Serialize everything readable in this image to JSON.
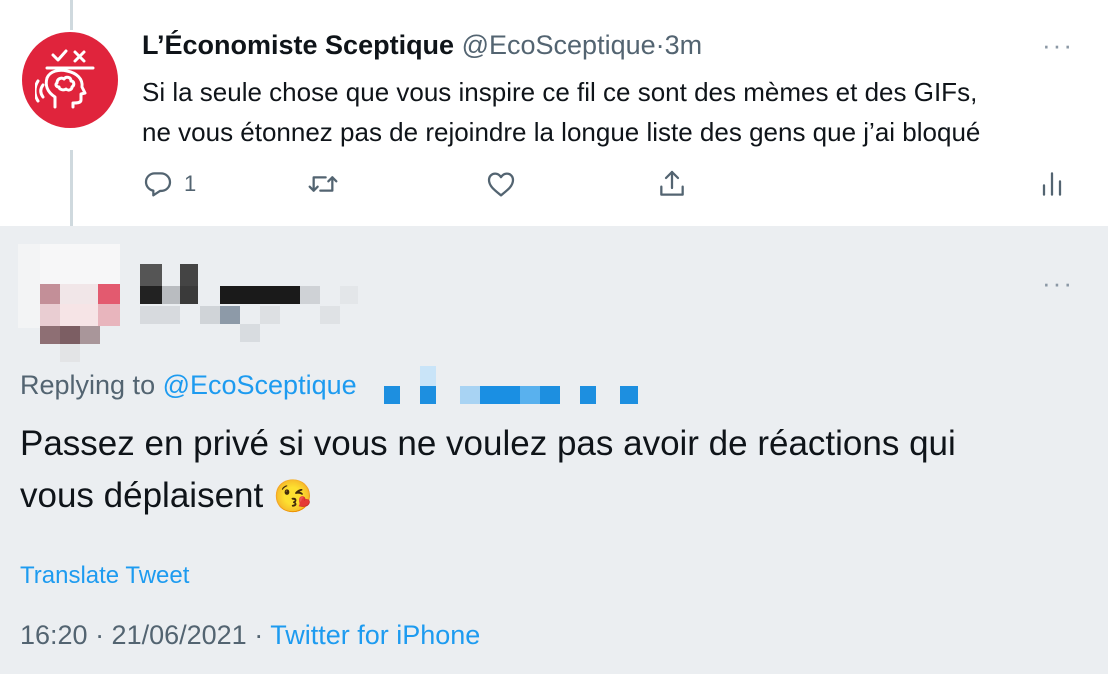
{
  "parent_tweet": {
    "display_name": "L’Économiste Sceptique",
    "handle": "@EcoSceptique",
    "separator": "·",
    "time": "3m",
    "more": "···",
    "text_lines": [
      "Si la seule chose que vous inspire ce fil ce sont des mèmes et des GIFs,",
      "ne vous étonnez pas de rejoindre la longue liste des gens que j’ai bloqué"
    ],
    "reply_count": "1",
    "avatar_color": "#e0243c"
  },
  "reply_tweet": {
    "more": "···",
    "replying_prefix": "Replying to ",
    "replying_mention": "@EcoSceptique",
    "text_line1": "Passez en privé si vous ne voulez pas avoir de réactions qui",
    "text_line2": "vous déplaisent ",
    "emoji": "😘",
    "translate_label": "Translate Tweet",
    "timestamp": "16:20 · 21/06/2021 · ",
    "source": "Twitter for iPhone"
  },
  "colors": {
    "accent": "#1d9bf0",
    "secondary_text": "#536471",
    "reply_background": "#ebeef1"
  },
  "icons": [
    "reply-icon",
    "retweet-icon",
    "like-icon",
    "share-icon",
    "analytics-icon",
    "more-icon"
  ]
}
